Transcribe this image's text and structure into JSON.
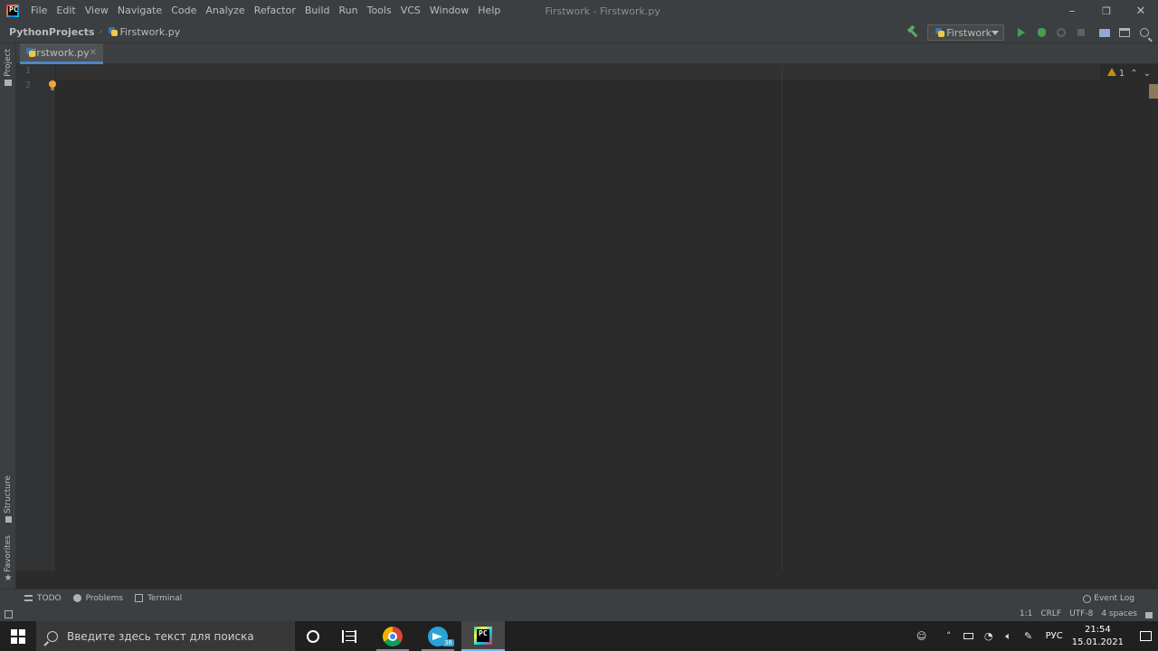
{
  "titlebar": {
    "menu": [
      "File",
      "Edit",
      "View",
      "Navigate",
      "Code",
      "Analyze",
      "Refactor",
      "Build",
      "Run",
      "Tools",
      "VCS",
      "Window",
      "Help"
    ],
    "window_title": "Firstwork - Firstwork.py",
    "minimize": "–",
    "restore": "❐",
    "close": "✕"
  },
  "navbar": {
    "project": "PythonProjects",
    "separator": "›",
    "file": "Firstwork.py",
    "run_config": "Firstwork"
  },
  "left_tools": {
    "project": "Project",
    "structure": "Structure",
    "favorites": "Favorites"
  },
  "editor": {
    "tab_label": "Firstwork.py",
    "tab_close": "✕",
    "line_numbers": [
      "1",
      "2"
    ],
    "warnings_count": "1"
  },
  "bottom_tools": {
    "todo": "TODO",
    "problems": "Problems",
    "terminal": "Terminal",
    "event_log": "Event Log"
  },
  "status": {
    "position": "1:1",
    "line_sep": "CRLF",
    "encoding": "UTF-8",
    "indent": "4 spaces"
  },
  "taskbar": {
    "search_placeholder": "Введите здесь текст для поиска",
    "telegram_badge": "36",
    "lang": "РУС",
    "time": "21:54",
    "date": "15.01.2021"
  },
  "colors": {
    "accent": "#4a88c7",
    "run_green": "#499c54",
    "warning": "#be9117"
  }
}
